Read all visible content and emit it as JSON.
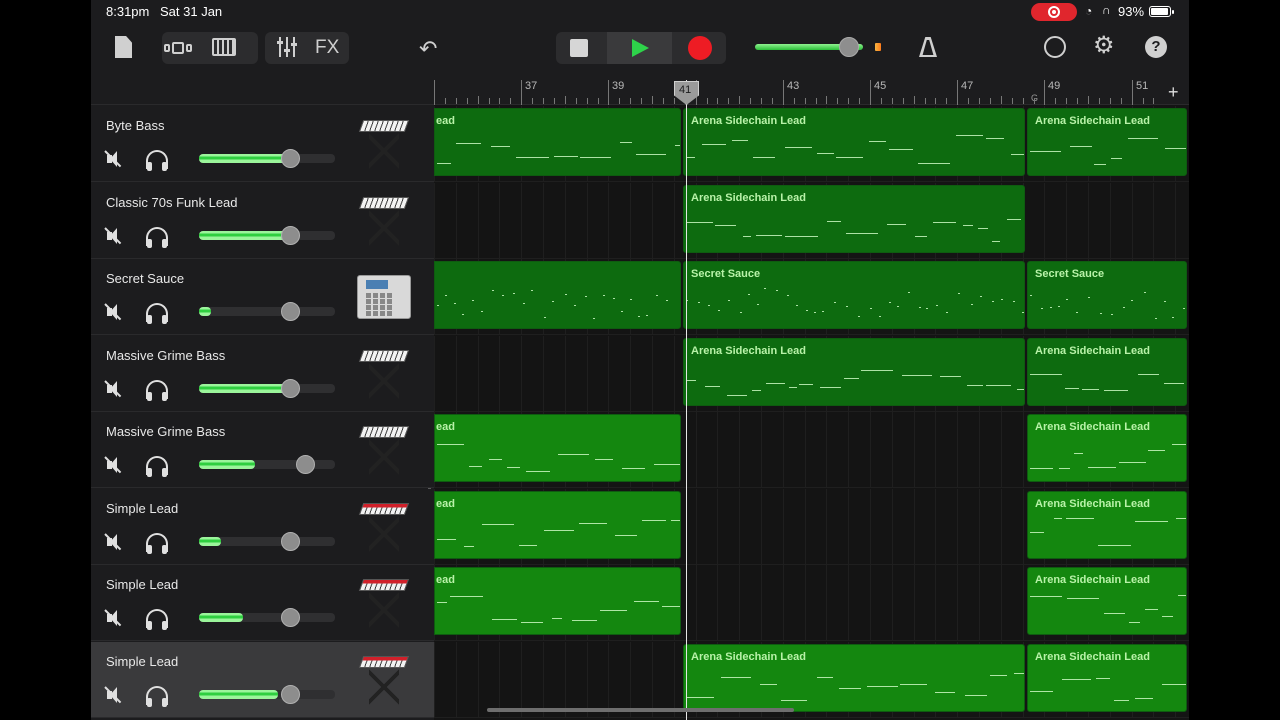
{
  "status_bar": {
    "time": "8:31pm",
    "date": "Sat 31 Jan",
    "battery": "93%",
    "icons": [
      "screen-record-icon",
      "wifi-icon",
      "headphones-icon",
      "battery-icon"
    ]
  },
  "toolbar": {
    "fx_label": "FX",
    "icons": [
      "document-icon",
      "tracks-view-icon",
      "keyboard-icon",
      "mixer-icon",
      "undo-icon",
      "stop-icon",
      "play-icon",
      "record-icon",
      "metronome-icon",
      "loop-browser-icon",
      "settings-gear-icon",
      "help-icon"
    ],
    "master_volume": 0.88,
    "colors": {
      "play": "#2ed34a",
      "record": "#ee1c24",
      "level": "#f5b642"
    }
  },
  "ruler": {
    "bar_numbers": [
      "37",
      "39",
      "41",
      "43",
      "45",
      "47",
      "49",
      "51"
    ],
    "marker": "G",
    "playhead_bar": "41",
    "add_track_label": "+"
  },
  "tracks": [
    {
      "name": "Byte Bass",
      "instrument": "synth-keyboard",
      "volume": 0.71,
      "muted": true
    },
    {
      "name": "Classic 70s Funk Lead",
      "instrument": "synth-keyboard",
      "volume": 0.71,
      "muted": true
    },
    {
      "name": "Secret Sauce",
      "instrument": "drum-machine",
      "volume": 0.71,
      "muted": true
    },
    {
      "name": "Massive Grime Bass",
      "instrument": "synth-keyboard",
      "volume": 0.71,
      "muted": true
    },
    {
      "name": "Massive Grime Bass",
      "instrument": "synth-keyboard",
      "volume": 0.84,
      "muted": true
    },
    {
      "name": "Simple Lead",
      "instrument": "red-synth-keyboard",
      "volume": 0.71,
      "muted": true
    },
    {
      "name": "Simple Lead",
      "instrument": "red-synth-keyboard",
      "volume": 0.71,
      "muted": true
    },
    {
      "name": "Simple Lead",
      "instrument": "red-synth-keyboard",
      "volume": 0.71,
      "muted": true,
      "selected": true
    }
  ],
  "regions": [
    {
      "track": 0,
      "label": "ead",
      "start_bar": 35.0,
      "end_bar": 40.7,
      "style": "dark"
    },
    {
      "track": 0,
      "label": "Arena Sidechain Lead",
      "start_bar": 40.7,
      "end_bar": 48.6,
      "style": "dark"
    },
    {
      "track": 0,
      "label": "Arena Sidechain Lead",
      "start_bar": 48.6,
      "end_bar": 52.5,
      "style": "dark"
    },
    {
      "track": 1,
      "label": "Arena Sidechain Lead",
      "start_bar": 40.7,
      "end_bar": 48.6,
      "style": "dark"
    },
    {
      "track": 2,
      "label": "",
      "start_bar": 35.0,
      "end_bar": 40.7,
      "style": "dark"
    },
    {
      "track": 2,
      "label": "Secret Sauce",
      "start_bar": 40.7,
      "end_bar": 48.6,
      "style": "dark"
    },
    {
      "track": 2,
      "label": "Secret Sauce",
      "start_bar": 48.6,
      "end_bar": 52.5,
      "style": "dark"
    },
    {
      "track": 3,
      "label": "Arena Sidechain Lead",
      "start_bar": 40.7,
      "end_bar": 48.6,
      "style": "dark"
    },
    {
      "track": 3,
      "label": "Arena Sidechain Lead",
      "start_bar": 48.6,
      "end_bar": 52.5,
      "style": "dark"
    },
    {
      "track": 4,
      "label": "ead",
      "start_bar": 35.0,
      "end_bar": 40.7,
      "style": "light"
    },
    {
      "track": 4,
      "label": "Arena Sidechain Lead",
      "start_bar": 48.6,
      "end_bar": 52.5,
      "style": "light"
    },
    {
      "track": 5,
      "label": "ead",
      "start_bar": 35.0,
      "end_bar": 40.7,
      "style": "light"
    },
    {
      "track": 5,
      "label": "Arena Sidechain Lead",
      "start_bar": 48.6,
      "end_bar": 52.5,
      "style": "light"
    },
    {
      "track": 6,
      "label": "ead",
      "start_bar": 35.0,
      "end_bar": 40.7,
      "style": "light"
    },
    {
      "track": 6,
      "label": "Arena Sidechain Lead",
      "start_bar": 48.6,
      "end_bar": 52.5,
      "style": "light"
    },
    {
      "track": 7,
      "label": "Arena Sidechain Lead",
      "start_bar": 40.7,
      "end_bar": 48.6,
      "style": "light"
    },
    {
      "track": 7,
      "label": "Arena Sidechain Lead",
      "start_bar": 48.6,
      "end_bar": 52.5,
      "style": "light"
    }
  ]
}
